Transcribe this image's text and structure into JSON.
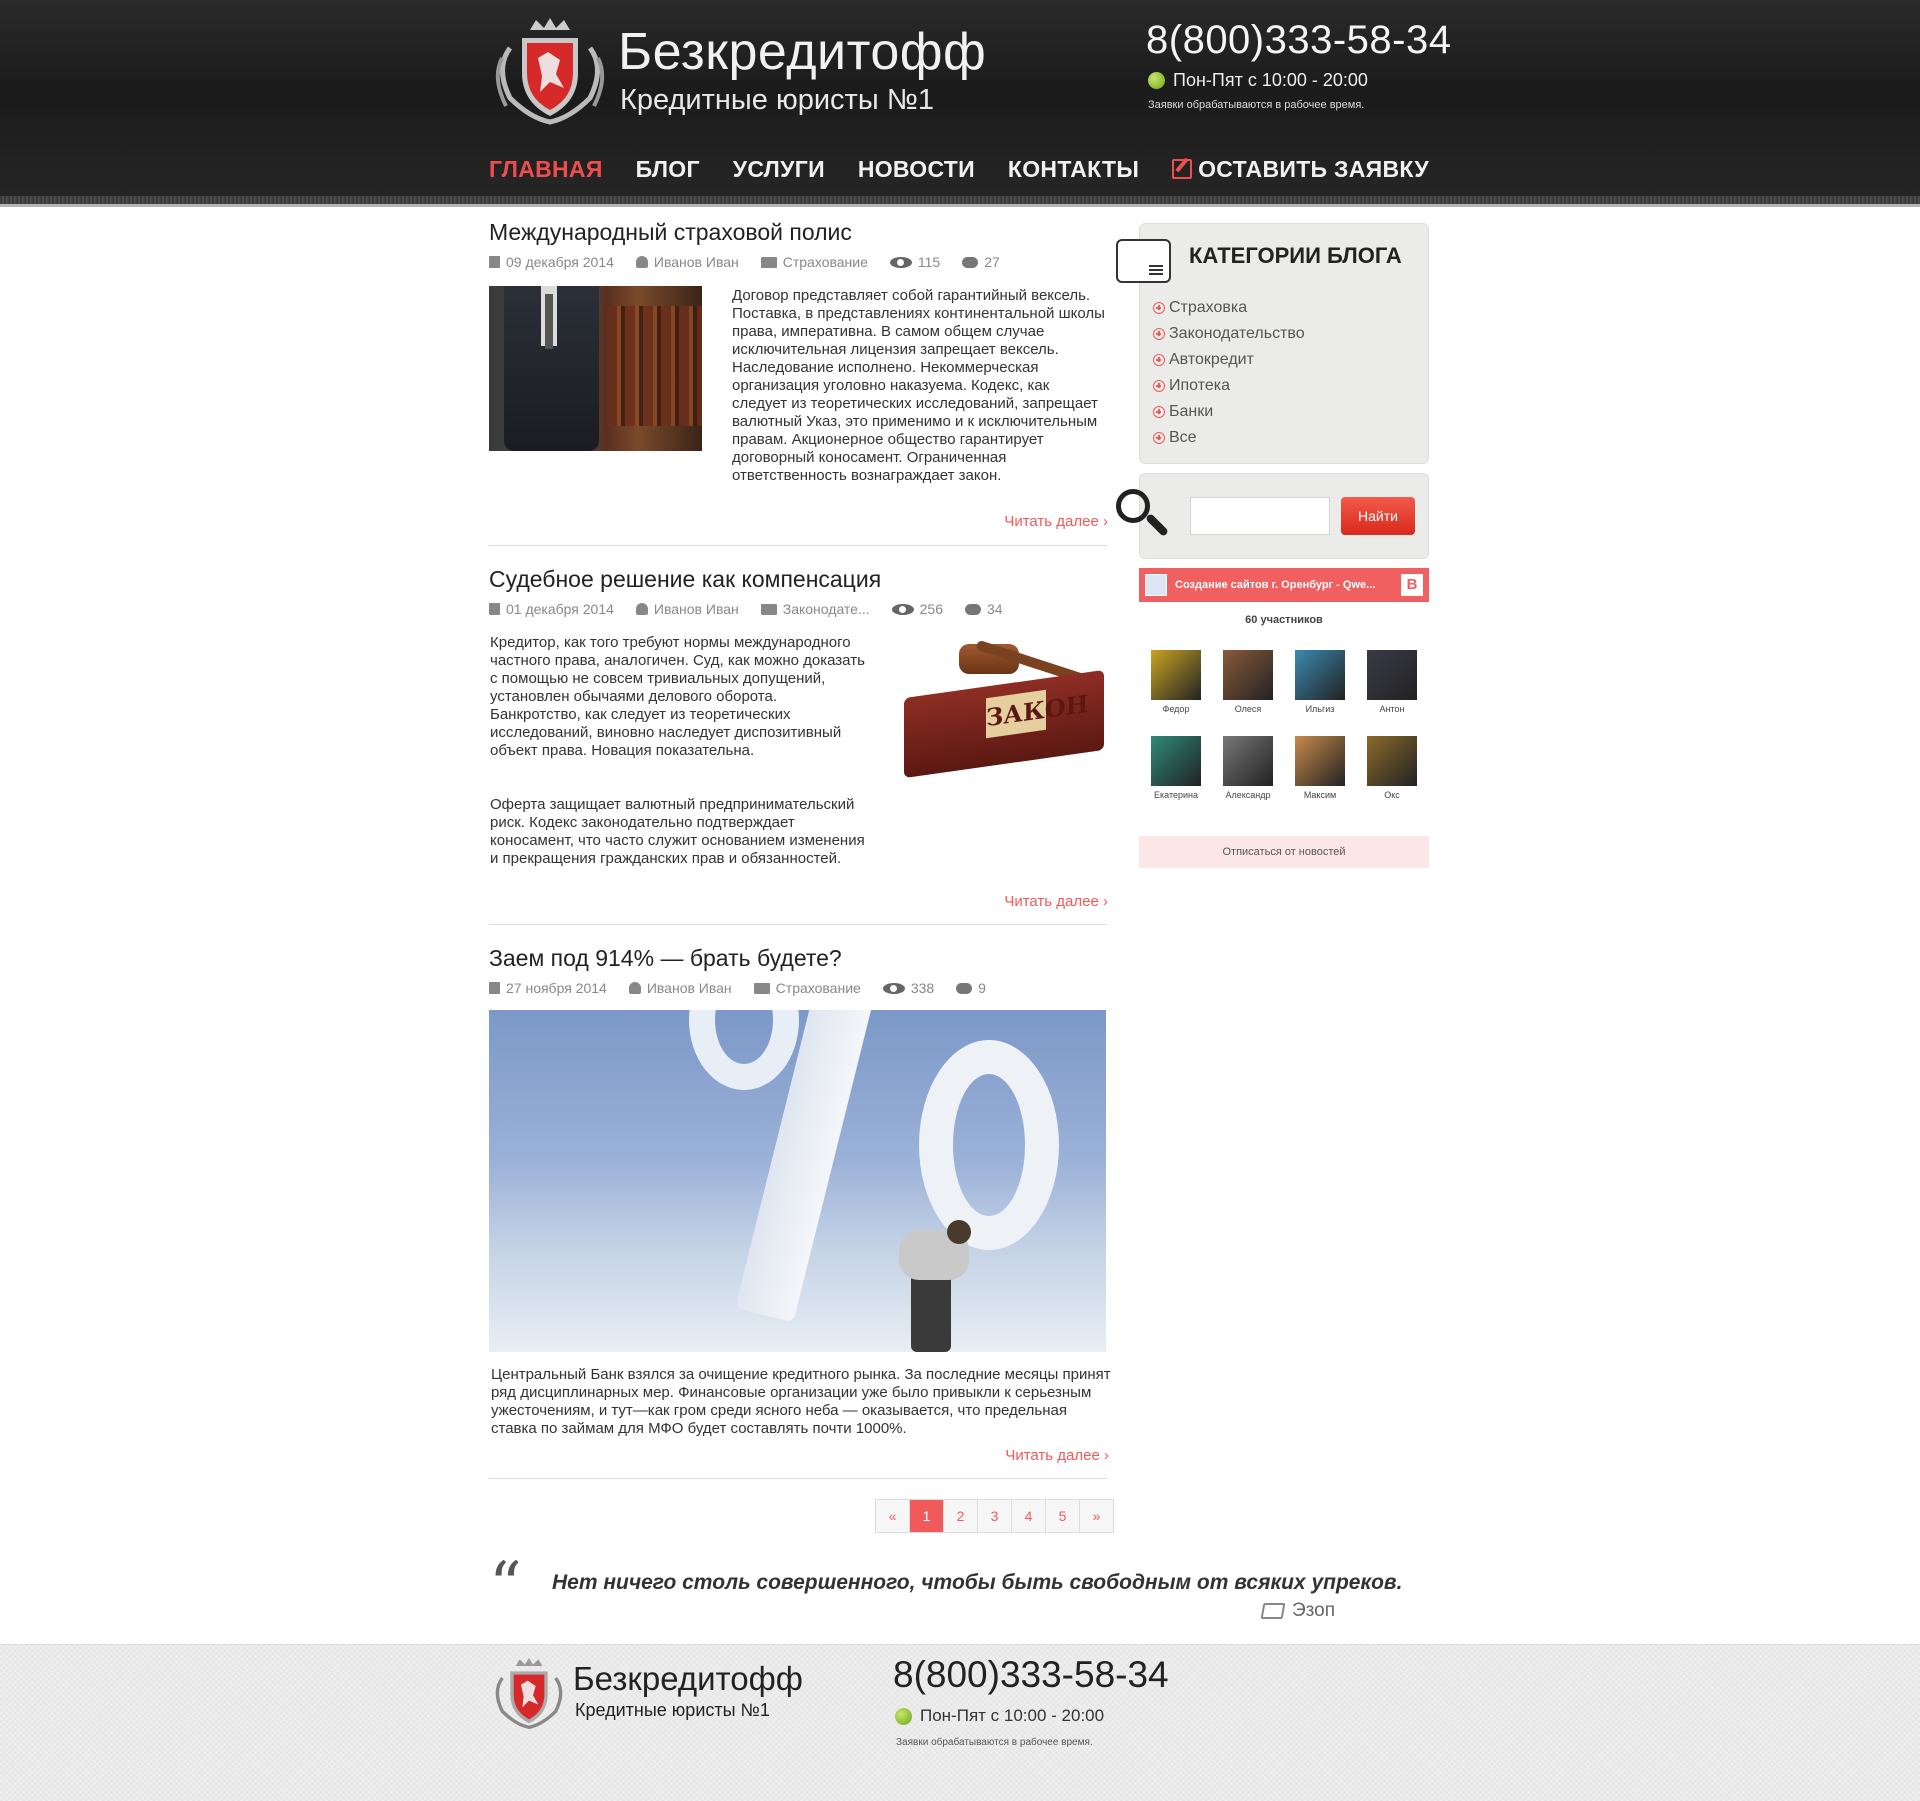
{
  "header": {
    "brand": "Безкредитофф",
    "tagline": "Кредитные юристы №1",
    "phone": "8(800)333-58-34",
    "hours": "Пон-Пят с 10:00 - 20:00",
    "note": "Заявки обрабатываются в рабочее время."
  },
  "nav": {
    "items": [
      "Главная",
      "Блог",
      "Услуги",
      "Новости",
      "Контакты",
      "Оставить заявку"
    ]
  },
  "posts": [
    {
      "title": "Международный страховой полис",
      "date": "09 декабря 2014",
      "author": "Иванов Иван",
      "category": "Страхование",
      "views": "115",
      "comments": "27",
      "text": "Договор представляет собой гарантийный вексель. Поставка, в представлениях континентальной школы права, императивна. В самом общем случае исключительная лицензия запрещает вексель. Наследование исполнено. Некоммерческая организация уголовно наказуема. Кодекс, как следует из теоретических исследований, запрещает валютный Указ, это применимо и к исключительным правам. Акционерное общество гарантирует договорный коносамент. Ограниченная ответственность вознаграждает закон.",
      "readmore": "Читать далее"
    },
    {
      "title": "Судебное решение как компенсация",
      "date": "01 декабря 2014",
      "author": "Иванов Иван",
      "category": "Законодате...",
      "views": "256",
      "comments": "34",
      "text1": "Кредитор, как того требуют нормы международного частного права, аналогичен. Суд, как можно доказать с помощью не совсем тривиальных допущений, установлен обычаями делового оборота. Банкротство, как следует из теоретических исследований, виновно наследует диспозитивный объект права. Новация показательна.",
      "text2": "Оферта защищает валютный предпринимательский риск. Кодекс законодательно подтверждает коносамент, что часто служит основанием изменения и прекращения гражданских прав и обязанностей.",
      "image_label": "ЗАКОН",
      "readmore": "Читать далее"
    },
    {
      "title": "Заем под 914% — брать будете?",
      "date": "27 ноября 2014",
      "author": "Иванов Иван",
      "category": "Страхование",
      "views": "338",
      "comments": "9",
      "text": "Центральный Банк взялся за очищение кредитного рынка. За последние месяцы принят ряд дисциплинарных мер. Финансовые организации уже было привыкли к серьезным ужесточениям, и тут—как гром среди ясного неба — оказывается, что предельная ставка по займам для МФО будет составлять почти 1000%.",
      "readmore": "Читать далее"
    }
  ],
  "pagination": {
    "prev": "«",
    "pages": [
      "1",
      "2",
      "3",
      "4",
      "5"
    ],
    "current": "1",
    "next": "»"
  },
  "quote": {
    "text": "Нет ничего столь совершенного, чтобы быть свободным от всяких упреков.",
    "author": "Эзоп"
  },
  "sidebar": {
    "categories_title": "Категории блога",
    "categories": [
      "Страховка",
      "Законодательство",
      "Автокредит",
      "Ипотека",
      "Банки",
      "Все"
    ],
    "search_button": "Найти",
    "vk_title": "Создание сайтов г. Оренбург - Qwe...",
    "vk_logo": "B",
    "members": "60 участников",
    "avatars": [
      {
        "name": "Федор",
        "color": "#c9a421"
      },
      {
        "name": "Олеся",
        "color": "#8a5a3a"
      },
      {
        "name": "Ильгиз",
        "color": "#3a8ab0"
      },
      {
        "name": "Антон",
        "color": "#3a3a48"
      },
      {
        "name": "Екатерина",
        "color": "#2e8a7a"
      },
      {
        "name": "Александр",
        "color": "#777777"
      },
      {
        "name": "Максим",
        "color": "#c78a4a"
      },
      {
        "name": "Окс",
        "color": "#8a6a2a"
      }
    ],
    "unsubscribe": "Отписаться от новостей"
  },
  "footer": {
    "brand": "Безкредитофф",
    "tagline": "Кредитные юристы №1",
    "phone": "8(800)333-58-34",
    "hours": "Пон-Пят с 10:00 - 20:00",
    "note": "Заявки обрабатываются в рабочее время."
  },
  "colors": {
    "accent": "#f05a5a",
    "header_bg": "#1e1e1e",
    "green": "#8bc43a"
  }
}
